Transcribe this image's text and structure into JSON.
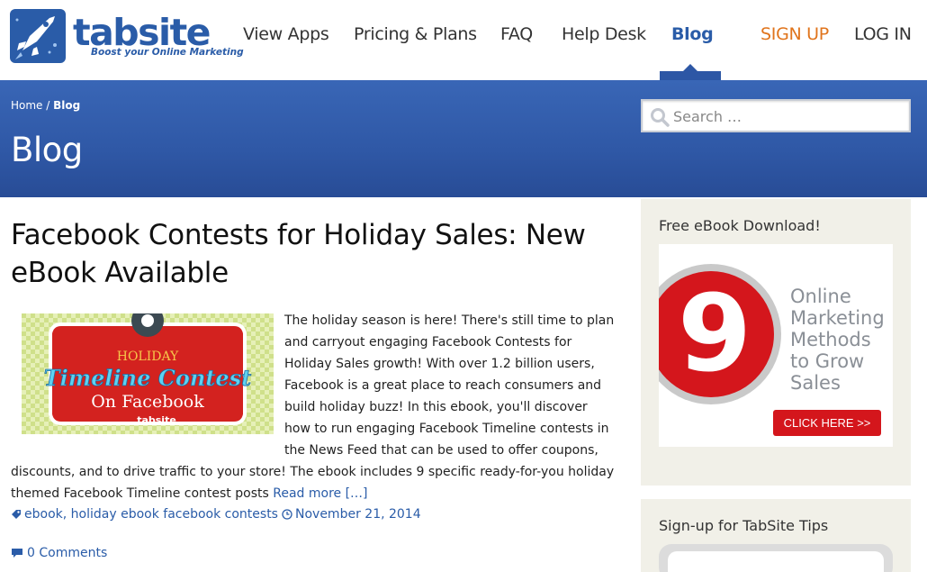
{
  "header": {
    "logo_text": "tabsite",
    "logo_tagline": "Boost your Online Marketing",
    "nav": {
      "view_apps": "View Apps",
      "pricing": "Pricing & Plans",
      "faq": "FAQ",
      "help_desk": "Help Desk",
      "blog": "Blog",
      "sign_up": "SIGN UP",
      "log_in": "LOG IN"
    }
  },
  "banner": {
    "breadcrumb_home": "Home",
    "breadcrumb_sep": " / ",
    "breadcrumb_current": "Blog",
    "title": "Blog",
    "search_placeholder": "Search …"
  },
  "article": {
    "title": "Facebook Contests for Holiday Sales: New eBook Available",
    "image_text_top": "HOLIDAY",
    "image_text_mid": "Timeline Contest",
    "image_text_bottom": "On Facebook",
    "image_brand": "tabsite",
    "body": "The holiday season is here! There's still time to plan and carryout engaging Facebook Contests for Holiday Sales growth! With over 1.2 billion users, Facebook is a great place to reach consumers and build holiday buzz! In this ebook, you'll discover how to run engaging Facebook Timeline contests in the News Feed that can be used to offer coupons, discounts, and to drive traffic to your store! The ebook includes 9 specific ready-for-you holiday themed Facebook Timeline contest posts ",
    "read_more": "Read more […]",
    "tags": [
      "ebook",
      "holiday ebook facebook contests"
    ],
    "tag_sep": ", ",
    "date": "November 21, 2014",
    "comments": "0 Comments"
  },
  "sidebar": {
    "ebook_widget_title": "Free eBook Download!",
    "ebook_number": "9",
    "ebook_lines": [
      "Online",
      "Marketing",
      "Methods",
      "to Grow",
      "Sales"
    ],
    "click_here": "CLICK HERE >>",
    "signup_widget_title": "Sign-up for TabSite Tips"
  },
  "colors": {
    "brand_blue": "#2a5ca8",
    "banner_blue": "#2f58a6",
    "signup_orange": "#e0741c",
    "cta_red": "#d4161c",
    "sidebar_bg": "#f1f0e8"
  }
}
